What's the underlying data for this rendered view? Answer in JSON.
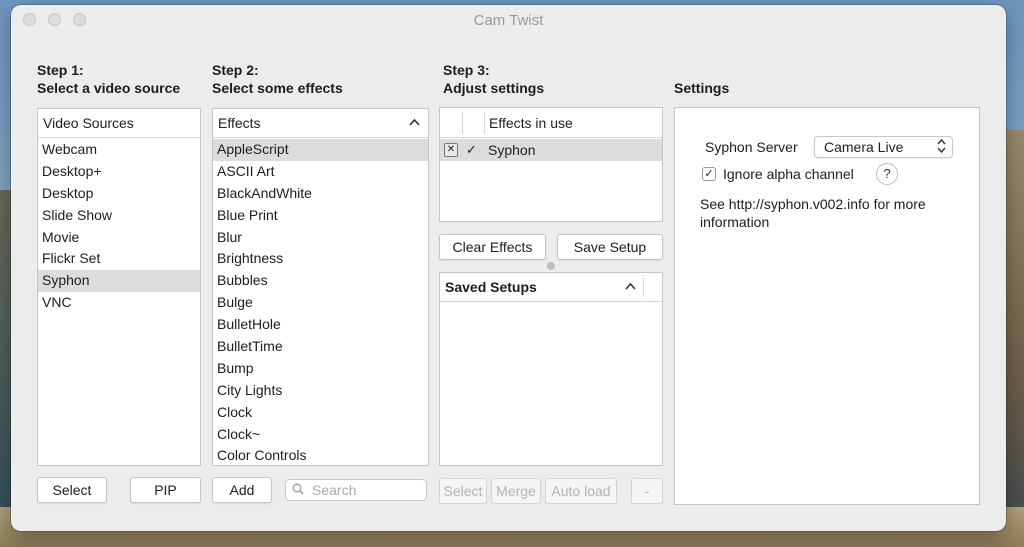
{
  "window": {
    "title": "Cam Twist"
  },
  "step1": {
    "heading1": "Step 1:",
    "heading2": "Select a video source",
    "list_header": "Video Sources",
    "items": [
      "Webcam",
      "Desktop+",
      "Desktop",
      "Slide Show",
      "Movie",
      "Flickr Set",
      "Syphon",
      "VNC"
    ],
    "selected": "Syphon",
    "select_button": "Select",
    "pip_button": "PIP"
  },
  "step2": {
    "heading1": "Step 2:",
    "heading2": "Select some effects",
    "list_header": "Effects",
    "items": [
      "AppleScript",
      "ASCII Art",
      "BlackAndWhite",
      "Blue Print",
      "Blur",
      "Brightness",
      "Bubbles",
      "Bulge",
      "BulletHole",
      "BulletTime",
      "Bump",
      "City Lights",
      "Clock",
      "Clock~",
      "Color Controls"
    ],
    "selected": "AppleScript",
    "add_button": "Add",
    "search_placeholder": "Search"
  },
  "step3": {
    "heading1": "Step 3:",
    "heading2": "Adjust settings",
    "effects_header": "Effects in use",
    "effects_in_use": [
      {
        "name": "Syphon",
        "enabled": true
      }
    ],
    "clear_button": "Clear Effects",
    "save_button": "Save Setup",
    "saved_header": "Saved Setups",
    "select_button": "Select",
    "merge_button": "Merge",
    "autoload_button": "Auto load",
    "remove_button": "-"
  },
  "settings": {
    "heading": "Settings",
    "server_label": "Syphon Server",
    "server_value": "Camera Live",
    "ignore_alpha_label": "Ignore alpha channel",
    "ignore_alpha_checked": true,
    "help_label": "?",
    "info_text": "See http://syphon.v002.info for more information"
  },
  "icons": {
    "close": "close-icon",
    "minimize": "minimize-icon",
    "zoom": "zoom-icon",
    "search": "search-icon",
    "sort": "chevron-up-icon",
    "remove": "x-box-icon",
    "check": "checkmark-icon",
    "updown": "updown-arrows-icon"
  }
}
